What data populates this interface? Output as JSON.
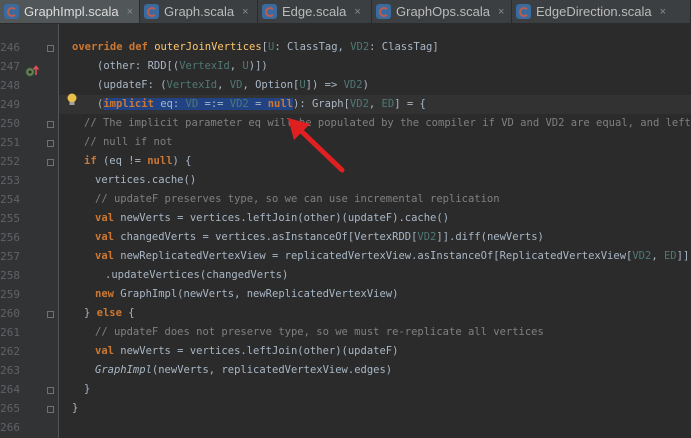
{
  "tabs": [
    {
      "label": "GraphImpl.scala",
      "active": true
    },
    {
      "label": "Graph.scala",
      "active": false
    },
    {
      "label": "Edge.scala",
      "active": false
    },
    {
      "label": "GraphOps.scala",
      "active": false
    },
    {
      "label": "EdgeDirection.scala",
      "active": false
    }
  ],
  "close_glyph": "×",
  "line_numbers": [
    "246",
    "247",
    "248",
    "249",
    "250",
    "251",
    "252",
    "253",
    "254",
    "255",
    "256",
    "257",
    "258",
    "259",
    "260",
    "261",
    "262",
    "263",
    "264",
    "265",
    "266"
  ],
  "code": {
    "l246": {
      "kw1": "override",
      "kw2": "def",
      "name": "outerJoinVertices",
      "rest1": "[",
      "tp1": "U",
      "rest2": ": ClassTag, ",
      "tp2": "VD2",
      "rest3": ": ClassTag]"
    },
    "l247": {
      "pre": "(other: RDD[(",
      "tp1": "VertexId",
      "mid": ", ",
      "tp2": "U",
      "post": ")])"
    },
    "l248": {
      "pre": "(updateF: (",
      "tp1": "VertexId",
      "c1": ", ",
      "tp2": "VD",
      "c2": ", Option[",
      "tp3": "U",
      "post": "]) => ",
      "tp4": "VD2",
      "end": ")"
    },
    "l249": {
      "sel_kw": "implicit",
      "sel_rest": " eq: ",
      "sel_tp1": "VD",
      "sel_op": " =:= ",
      "sel_tp2": "VD2",
      "sel_eq": " = ",
      "sel_null": "null",
      "post": "): Graph[",
      "tp1": "VD2",
      "c": ", ",
      "tp2": "ED",
      "end": "] = {"
    },
    "l250": "// The implicit parameter eq will be populated by the compiler if VD and VD2 are equal, and left",
    "l251": "// null if not",
    "l252": {
      "kw": "if",
      "pre": " (eq != ",
      "null": "null",
      "post": ") {"
    },
    "l253": "vertices.cache()",
    "l254": "// updateF preserves type, so we can use incremental replication",
    "l255": {
      "kw": "val",
      "post": " newVerts = vertices.leftJoin(other)(updateF).cache()"
    },
    "l256": {
      "kw": "val",
      "pre": " changedVerts = vertices.asInstanceOf[VertexRDD[",
      "tp": "VD2",
      "post": "]].diff(newVerts)"
    },
    "l257": {
      "kw": "val",
      "pre": " newReplicatedVertexView = replicatedVertexView.asInstanceOf[ReplicatedVertexView[",
      "tp1": "VD2",
      "c": ", ",
      "tp2": "ED",
      "post": "]]"
    },
    "l258": ".updateVertices(changedVerts)",
    "l259": {
      "kw": "new",
      "post": " GraphImpl(newVerts, newReplicatedVertexView)"
    },
    "l260": {
      "pre": "} ",
      "kw": "else",
      "post": " {"
    },
    "l261": "// updateF does not preserve type, so we must re-replicate all vertices",
    "l262": {
      "kw": "val",
      "post": " newVerts = vertices.leftJoin(other)(updateF)"
    },
    "l263": {
      "it": "GraphImpl",
      "post": "(newVerts, replicatedVertexView.edges)"
    },
    "l264": "}",
    "l265": "}",
    "l266": ""
  },
  "colors": {
    "keyword": "#cc7832",
    "type_param": "#507874",
    "comment": "#808080",
    "selection": "#214283",
    "arrow": "#e02020"
  },
  "icons": [
    "scala-file-icon",
    "override-method-icon",
    "intention-bulb-icon",
    "fold-marker-icon",
    "annotation-arrow-icon"
  ]
}
